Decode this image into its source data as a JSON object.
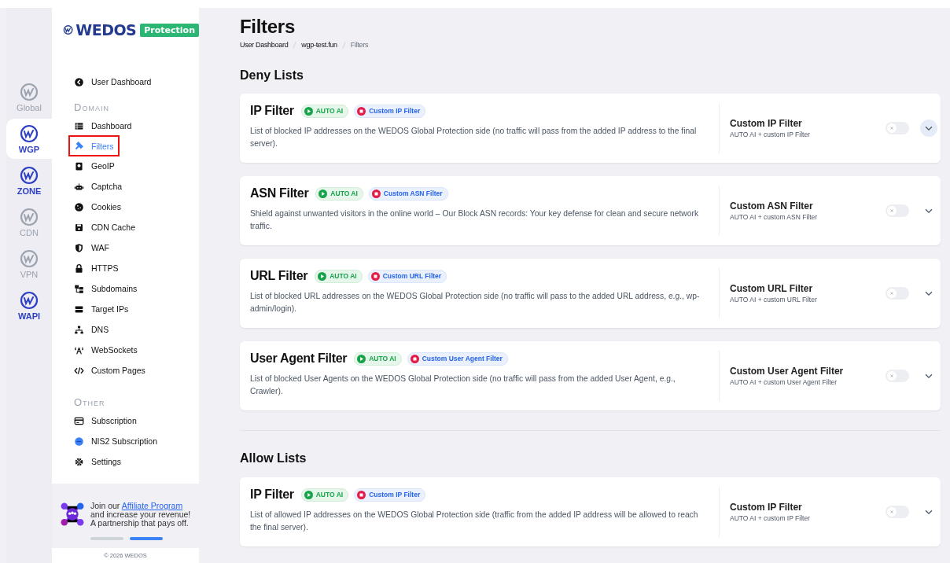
{
  "rail": [
    {
      "label": "Global",
      "active": false,
      "selected": false
    },
    {
      "label": "WGP",
      "active": true,
      "selected": true
    },
    {
      "label": "ZONE",
      "active": true,
      "selected": false
    },
    {
      "label": "CDN",
      "active": false,
      "selected": false
    },
    {
      "label": "VPN",
      "active": false,
      "selected": false
    },
    {
      "label": "WAPI",
      "active": true,
      "selected": false
    }
  ],
  "logo": {
    "brand": "WEDOS",
    "badge": "Protection"
  },
  "back_link": "User Dashboard",
  "sidebar": [
    {
      "heading": "Domain",
      "items": [
        {
          "label": "Dashboard",
          "selected": false
        },
        {
          "label": "Filters",
          "selected": true
        },
        {
          "label": "GeoIP",
          "selected": false
        },
        {
          "label": "Captcha",
          "selected": false
        },
        {
          "label": "Cookies",
          "selected": false
        },
        {
          "label": "CDN Cache",
          "selected": false
        },
        {
          "label": "WAF",
          "selected": false
        },
        {
          "label": "HTTPS",
          "selected": false
        },
        {
          "label": "Subdomains",
          "selected": false
        },
        {
          "label": "Target IPs",
          "selected": false
        },
        {
          "label": "DNS",
          "selected": false
        },
        {
          "label": "WebSockets",
          "selected": false
        },
        {
          "label": "Custom Pages",
          "selected": false
        }
      ]
    },
    {
      "heading": "Other",
      "items": [
        {
          "label": "Subscription",
          "selected": false
        },
        {
          "label": "NIS2 Subscription",
          "selected": false
        },
        {
          "label": "Settings",
          "selected": false
        }
      ]
    }
  ],
  "affiliate": {
    "before": "Join our",
    "link": "Affiliate Program",
    "after": "and increase your revenue! A partnership that pays off.",
    "pages": [
      {
        "selected": false
      },
      {
        "selected": true
      }
    ]
  },
  "footer": "© 2026 WEDOS",
  "title": "Filters",
  "breadcrumb": [
    "User Dashboard",
    "wgp-test.fun",
    "Filters"
  ],
  "sections": [
    {
      "heading": "Deny Lists",
      "cards": [
        {
          "title": "IP Filter",
          "badges": [
            {
              "kind": "auto",
              "label": "AUTO AI"
            },
            {
              "kind": "custom",
              "label": "Custom IP Filter"
            }
          ],
          "description": "List of blocked IP addresses on the WEDOS Global Protection side (no traffic will pass from the added IP address to the final server).",
          "mode": "Custom IP Filter",
          "mode_detail": "AUTO AI + custom IP Filter",
          "on": false,
          "focused": true
        },
        {
          "title": "ASN Filter",
          "badges": [
            {
              "kind": "auto",
              "label": "AUTO AI"
            },
            {
              "kind": "custom",
              "label": "Custom ASN Filter"
            }
          ],
          "description": "Shield against unwanted visitors in the online world – Our Block ASN records: Your key defense for clean and secure network traffic.",
          "mode": "Custom ASN Filter",
          "mode_detail": "AUTO AI + custom ASN Filter",
          "on": false,
          "focused": false
        },
        {
          "title": "URL Filter",
          "badges": [
            {
              "kind": "auto",
              "label": "AUTO AI"
            },
            {
              "kind": "custom",
              "label": "Custom URL Filter"
            }
          ],
          "description": "List of blocked URL addresses on the WEDOS Global Protection side (no traffic will pass to the added URL address, e.g., wp-admin/login).",
          "mode": "Custom URL Filter",
          "mode_detail": "AUTO AI + custom URL Filter",
          "on": false,
          "focused": false
        },
        {
          "title": "User Agent Filter",
          "badges": [
            {
              "kind": "auto",
              "label": "AUTO AI"
            },
            {
              "kind": "custom",
              "label": "Custom User Agent Filter"
            }
          ],
          "description": "List of blocked User Agents on the WEDOS Global Protection side (no traffic will pass from the added User Agent, e.g., Crawler).",
          "mode": "Custom User Agent Filter",
          "mode_detail": "AUTO AI + custom User Agent Filter",
          "on": false,
          "focused": false
        }
      ]
    },
    {
      "heading": "Allow Lists",
      "cards": [
        {
          "title": "IP Filter",
          "badges": [
            {
              "kind": "auto",
              "label": "AUTO AI"
            },
            {
              "kind": "custom",
              "label": "Custom IP Filter"
            }
          ],
          "description": "List of allowed IP addresses on the WEDOS Global Protection side (traffic from the added IP address will be allowed to reach the final server).",
          "mode": "Custom IP Filter",
          "mode_detail": "AUTO AI + custom IP Filter",
          "on": false,
          "focused": false
        }
      ]
    }
  ]
}
